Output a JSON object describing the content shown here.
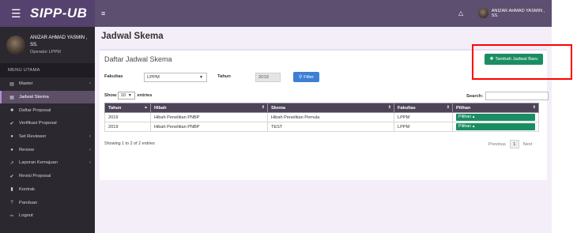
{
  "brand": {
    "name": "SIPP-UB"
  },
  "user": {
    "name": "ANIZAR AHMAD YASMIN , SS.",
    "role": "Operator LPPM",
    "top_name": "ANIZAR AHMAD YASMIN , SS."
  },
  "sidebar": {
    "header": "MENU UTAMA",
    "items": [
      {
        "label": "Master",
        "icon": "menu-icon"
      },
      {
        "label": "Jadwal Skema",
        "icon": "calendar-icon"
      },
      {
        "label": "Daftar Proposal",
        "icon": "book-icon"
      },
      {
        "label": "Verifikasi Proposal",
        "icon": "check-circle-icon"
      },
      {
        "label": "Set Reviewer",
        "icon": "users-icon"
      },
      {
        "label": "Review",
        "icon": "users-icon"
      },
      {
        "label": "Laporan Kemajuan",
        "icon": "chart-icon"
      },
      {
        "label": "Revisi Proposal",
        "icon": "check-circle-icon"
      },
      {
        "label": "Kontrak",
        "icon": "file-icon"
      },
      {
        "label": "Panduan",
        "icon": "help-icon"
      },
      {
        "label": "Logout",
        "icon": "logout-icon"
      }
    ]
  },
  "page": {
    "title": "Jadwal Skema",
    "box_title": "Daftar Jadwal Skema",
    "add_button": "Tambah Jadwal Baru",
    "filter": {
      "fakultas_label": "Fakultas",
      "fakultas_value": "LPPM",
      "tahun_label": "Tahun",
      "tahun_value": "2019",
      "button": "Filter"
    },
    "show_label": "Show",
    "show_value": "10",
    "entries_label": "entries",
    "search_label": "Search:"
  },
  "table": {
    "columns": [
      "Tahun",
      "Hibah",
      "Skema",
      "Fakultas",
      "Pilihan"
    ],
    "rows": [
      {
        "tahun": "2019",
        "hibah": "Hibah Penelitian PNBP",
        "skema": "Hibah Penelitian Pemula",
        "fakultas": "LPPM",
        "pilihan": "Pilihan"
      },
      {
        "tahun": "2019",
        "hibah": "Hibah Penelitian PNBP",
        "skema": "TEST",
        "fakultas": "LPPM",
        "pilihan": "Pilihan"
      }
    ],
    "info": "Showing 1 to 2 of 2 entries",
    "pager": {
      "previous": "Previous",
      "current": "1",
      "next": "Next"
    }
  },
  "colors": {
    "sidebar": "#2b2830",
    "topbar": "#5d4f6f",
    "accent_green": "#1a8d63",
    "filter_blue": "#3d7fd4",
    "highlight": "#ff0000"
  }
}
